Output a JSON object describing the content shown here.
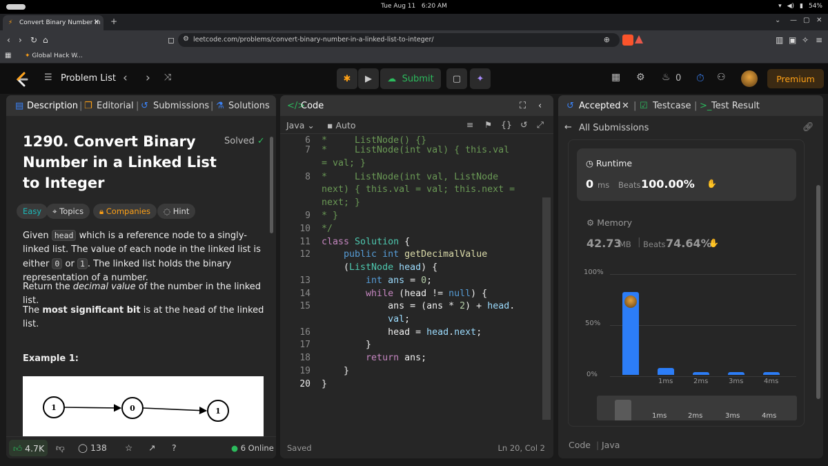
{
  "os": {
    "date": "Tue Aug 11",
    "time": "6:20 AM",
    "battery": "54%"
  },
  "browser": {
    "tab_title": "Convert Binary Number in",
    "url": "leetcode.com/problems/convert-binary-number-in-a-linked-list-to-integer/",
    "bookmark": "Global Hack W..."
  },
  "header": {
    "problem_list": "Problem List",
    "submit": "Submit",
    "streak": "0",
    "premium": "Premium"
  },
  "left": {
    "tabs": [
      "Description",
      "Editorial",
      "Submissions",
      "Solutions"
    ],
    "title": "1290. Convert Binary Number in a Linked List to Integer",
    "solved": "Solved",
    "tags": [
      "Easy",
      "Topics",
      "Companies",
      "Hint"
    ],
    "p1_a": "Given ",
    "p1_code1": "head",
    "p1_b": " which is a reference node to a singly-linked list. The value of each node in the linked list is either ",
    "p1_code2": "0",
    "p1_c": " or ",
    "p1_code3": "1",
    "p1_d": ". The linked list holds the binary representation of a number.",
    "p2_a": "Return the ",
    "p2_em": "decimal value",
    "p2_b": " of the number in the linked list.",
    "p3_a": "The ",
    "p3_strong": "most significant bit",
    "p3_b": " is at the head of the linked list.",
    "example": "Example 1:",
    "diagram": [
      "1",
      "0",
      "1"
    ],
    "likes": "4.7K",
    "comments": "138",
    "online": "6 Online"
  },
  "code": {
    "tab": "Code",
    "lang": "Java",
    "mode": "Auto",
    "saved": "Saved",
    "cursor": "Ln 20, Col 2",
    "line_numbers": [
      "6",
      "7",
      "",
      "8",
      "",
      "",
      "9",
      "10",
      "11",
      "12",
      "",
      "13",
      "14",
      "15",
      "",
      "16",
      "17",
      "18",
      "19",
      "20"
    ]
  },
  "right": {
    "tabs": [
      "Accepted",
      "Testcase",
      "Test Result"
    ],
    "all_submissions": "All Submissions",
    "runtime_label": "Runtime",
    "runtime_value": "0",
    "runtime_unit": "ms",
    "beats_label": "Beats",
    "runtime_beats": "100.00%",
    "memory_label": "Memory",
    "memory_value": "42.73",
    "memory_unit": "MB",
    "memory_beats": "74.64%",
    "y_ticks": [
      "100%",
      "50%",
      "0%"
    ],
    "x_ticks": [
      "1ms",
      "2ms",
      "3ms",
      "4ms"
    ],
    "mini_ticks": [
      "1ms",
      "2ms",
      "3ms",
      "4ms"
    ],
    "footer_code": "Code",
    "footer_lang": "Java"
  },
  "chart_data": {
    "type": "bar",
    "categories": [
      "0ms",
      "1ms",
      "2ms",
      "3ms",
      "4ms"
    ],
    "values": [
      81,
      7,
      2.5,
      2.5,
      2.5
    ],
    "ylim": [
      0,
      100
    ]
  }
}
